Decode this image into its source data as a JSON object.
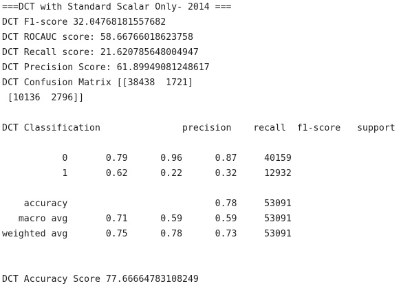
{
  "console": {
    "lines": [
      "===DCT with Standard Scalar Only- 2014 ===",
      "DCT F1-score 32.04768181557682",
      "DCT ROCAUC score: 58.66766018623758",
      "DCT Recall score: 21.620785648004947",
      "DCT Precision Score: 61.89949081248617",
      "DCT Confusion Matrix [[38438  1721]",
      " [10136  2796]]",
      "",
      "DCT Classification               precision    recall  f1-score   support",
      "",
      "           0       0.79      0.96      0.87     40159",
      "           1       0.62      0.22      0.32     12932",
      "",
      "    accuracy                           0.78     53091",
      "   macro avg       0.71      0.59      0.59     53091",
      "weighted avg       0.75      0.78      0.73     53091",
      "",
      "",
      "DCT Accuracy Score 77.66664783108249"
    ]
  }
}
